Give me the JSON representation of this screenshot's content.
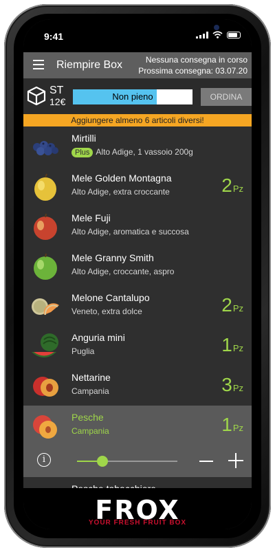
{
  "status": {
    "time": "9:41"
  },
  "header": {
    "title": "Riempire Box",
    "delivery_status": "Nessuna consegna in corso",
    "next_delivery": "Prossima consegna: 03.07.20"
  },
  "box": {
    "size": "ST",
    "price": "12€",
    "fill_label": "Non pieno",
    "fill_fraction": 0.7,
    "order_label": "ORDINA"
  },
  "warning": "Aggiungere almeno 6 articoli diversi!",
  "items": [
    {
      "name": "Mirtilli",
      "badge": "Plus",
      "desc": "Alto Adige, 1 vassoio 200g",
      "qty": "",
      "unit": ""
    },
    {
      "name": "Mele Golden Montagna",
      "desc": "Alto Adige, extra croccante",
      "qty": "2",
      "unit": "Pz"
    },
    {
      "name": "Mele Fuji",
      "desc": "Alto Adige, aromatica e succosa",
      "qty": "",
      "unit": ""
    },
    {
      "name": "Mele Granny Smith",
      "desc": "Alto Adige, croccante, aspro",
      "qty": "",
      "unit": ""
    },
    {
      "name": "Melone Cantalupo",
      "desc": "Veneto, extra dolce",
      "qty": "2",
      "unit": "Pz"
    },
    {
      "name": "Anguria mini",
      "desc": "Puglia",
      "qty": "1",
      "unit": "Pz"
    },
    {
      "name": "Nettarine",
      "desc": "Campania",
      "qty": "3",
      "unit": "Pz"
    },
    {
      "name": "Pesche",
      "desc": "Campania",
      "qty": "1",
      "unit": "Pz"
    }
  ],
  "controls": {
    "info": "i",
    "slider_value": 0.25
  },
  "partial_item": {
    "name": "Pesche tabacchiere"
  },
  "footer": {
    "logo": "FROX",
    "tagline": "YOUR FRESH FRUIT BOX"
  },
  "colors": {
    "accent": "#9fd64a",
    "warning": "#f5a623",
    "progress": "#55c3ef"
  }
}
